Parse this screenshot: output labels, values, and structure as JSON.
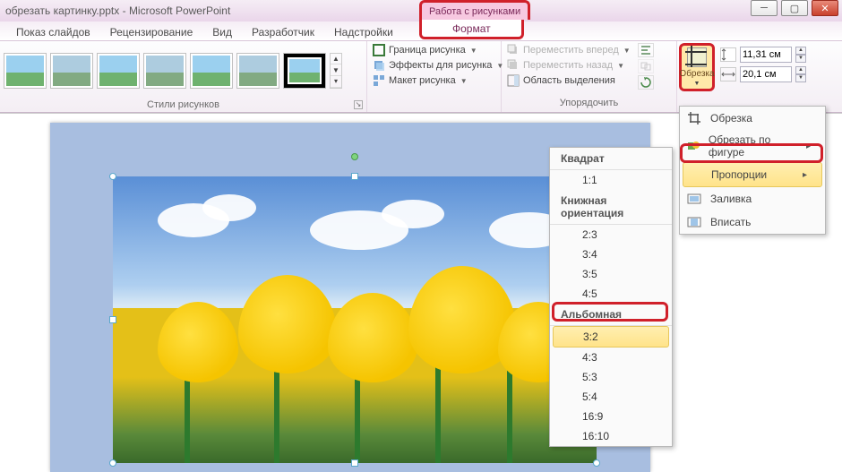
{
  "title": {
    "filename": "обрезать картинку.pptx",
    "app": "Microsoft PowerPoint"
  },
  "context_tab": {
    "group": "Работа с рисунками",
    "tab": "Формат"
  },
  "tabs": [
    "Показ слайдов",
    "Рецензирование",
    "Вид",
    "Разработчик",
    "Надстройки"
  ],
  "groups": {
    "styles": {
      "label": "Стили рисунков"
    },
    "arrange": {
      "label": "Упорядочить",
      "items": {
        "border": "Граница рисунка",
        "effects": "Эффекты для рисунка",
        "layout": "Макет рисунка",
        "forward": "Переместить вперед",
        "backward": "Переместить назад",
        "selection_pane": "Область выделения"
      }
    },
    "size": {
      "crop": "Обрезка",
      "height": "11,31 см",
      "width": "20,1 см"
    }
  },
  "crop_menu": {
    "crop": "Обрезка",
    "crop_to_shape": "Обрезать по фигуре",
    "aspect": "Пропорции",
    "fill": "Заливка",
    "fit": "Вписать"
  },
  "aspect_menu": {
    "square_hdr": "Квадрат",
    "square": [
      "1:1"
    ],
    "portrait_hdr": "Книжная ориентация",
    "portrait": [
      "2:3",
      "3:4",
      "3:5",
      "4:5"
    ],
    "landscape_hdr": "Альбомная",
    "landscape": [
      "3:2",
      "4:3",
      "5:3",
      "5:4",
      "16:9",
      "16:10"
    ],
    "selected": "3:2"
  }
}
